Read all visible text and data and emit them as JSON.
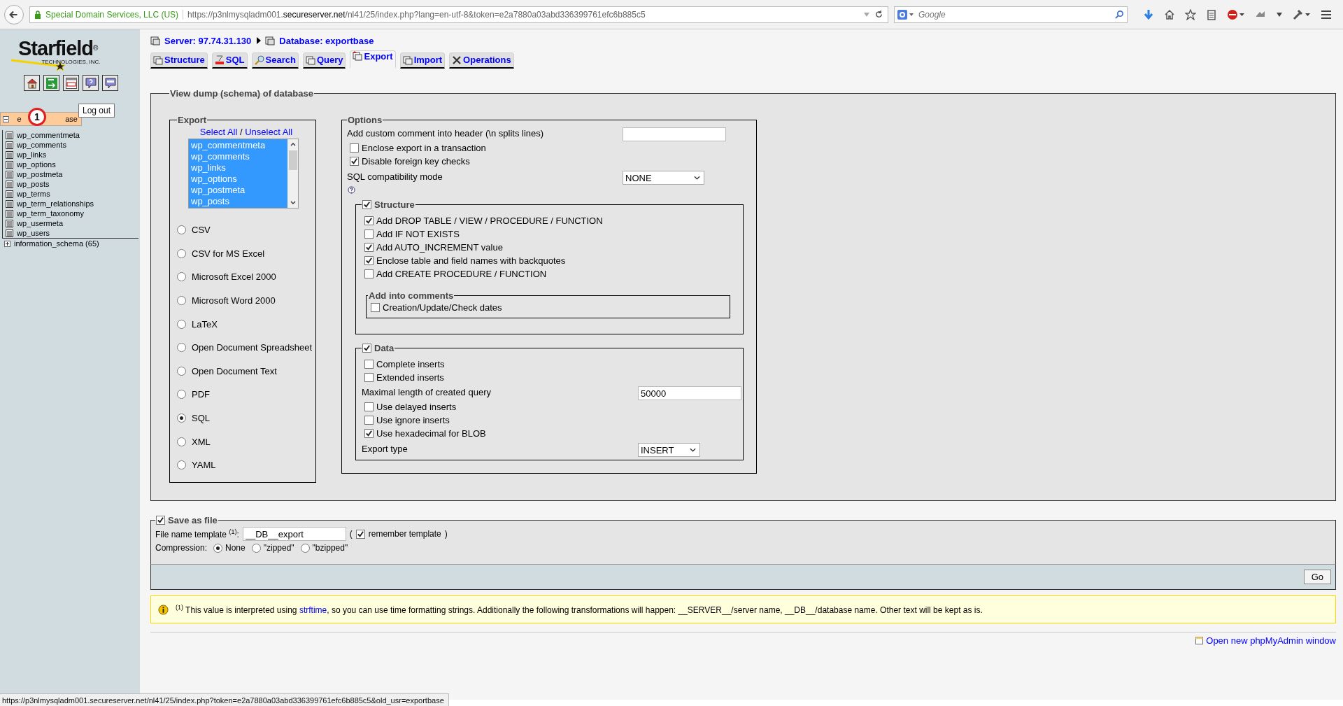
{
  "browser": {
    "identity": "Special Domain Services, LLC (US)",
    "url": "https://p3nlmysqladm001.**secureserver.net**/nl41/25/index.php?lang=en-utf-8&token=e2a7880a03abd336399761efc6b885c5",
    "search_placeholder": "Google"
  },
  "sidebar": {
    "logo": {
      "name": "Starfield",
      "mark": "®",
      "sub": "TECHNOLOGIES, INC."
    },
    "tooltip": "Log out",
    "annotation": "1",
    "database": {
      "label_start": "e",
      "label_end": "ase",
      "expanded": true,
      "selected": true,
      "tables": [
        {
          "label": "wp_commentmeta"
        },
        {
          "label": "wp_comments"
        },
        {
          "label": "wp_links"
        },
        {
          "label": "wp_options"
        },
        {
          "label": "wp_postmeta"
        },
        {
          "label": "wp_posts"
        },
        {
          "label": "wp_terms"
        },
        {
          "label": "wp_term_relationships"
        },
        {
          "label": "wp_term_taxonomy"
        },
        {
          "label": "wp_usermeta"
        },
        {
          "label": "wp_users"
        }
      ]
    },
    "other_databases": [
      {
        "label": "information_schema (65)",
        "expanded": false
      }
    ]
  },
  "breadcrumb": [
    {
      "label": "Server: 97.74.31.130"
    },
    {
      "label": "Database: exportbase"
    }
  ],
  "tabs": [
    {
      "label": "Structure",
      "selected": false
    },
    {
      "label": "SQL",
      "selected": false
    },
    {
      "label": "Search",
      "selected": false
    },
    {
      "label": "Query",
      "selected": false
    },
    {
      "label": "Export",
      "selected": true
    },
    {
      "label": "Import",
      "selected": false
    },
    {
      "label": "Operations",
      "selected": false
    }
  ],
  "main": {
    "legend": "View dump (schema) of database",
    "export": {
      "legend": "Export",
      "select_all": "Select All",
      "separator": "/",
      "unselect_all": "Unselect All",
      "tables": [
        {
          "label": "wp_commentmeta",
          "selected": true
        },
        {
          "label": "wp_comments",
          "selected": true
        },
        {
          "label": "wp_links",
          "selected": true
        },
        {
          "label": "wp_options",
          "selected": true
        },
        {
          "label": "wp_postmeta",
          "selected": true
        },
        {
          "label": "wp_posts",
          "selected": true
        }
      ],
      "formats": [
        {
          "label": "CSV",
          "selected": false
        },
        {
          "label": "CSV for MS Excel",
          "selected": false
        },
        {
          "label": "Microsoft Excel 2000",
          "selected": false
        },
        {
          "label": "Microsoft Word 2000",
          "selected": false
        },
        {
          "label": "LaTeX",
          "selected": false
        },
        {
          "label": "Open Document Spreadsheet",
          "selected": false
        },
        {
          "label": "Open Document Text",
          "selected": false
        },
        {
          "label": "PDF",
          "selected": false
        },
        {
          "label": "SQL",
          "selected": true
        },
        {
          "label": "XML",
          "selected": false
        },
        {
          "label": "YAML",
          "selected": false
        }
      ]
    },
    "options": {
      "legend": "Options",
      "comment_label": "Add custom comment into header (\\n splits lines)",
      "checks": [
        {
          "label": "Enclose export in a transaction",
          "checked": false
        },
        {
          "label": "Disable foreign key checks",
          "checked": true
        }
      ],
      "compat_label": "SQL compatibility mode",
      "compat_value": "NONE",
      "structure": {
        "legend": "Structure",
        "checked": true,
        "items": [
          {
            "label": "Add DROP TABLE / VIEW / PROCEDURE / FUNCTION",
            "checked": true
          },
          {
            "label": "Add IF NOT EXISTS",
            "checked": false
          },
          {
            "label": "Add AUTO_INCREMENT value",
            "checked": true
          },
          {
            "label": "Enclose table and field names with backquotes",
            "checked": true
          },
          {
            "label": "Add CREATE PROCEDURE / FUNCTION",
            "checked": false
          }
        ],
        "comments": {
          "legend": "Add into comments",
          "items": [
            {
              "label": "Creation/Update/Check dates",
              "checked": false
            }
          ]
        }
      },
      "data": {
        "legend": "Data",
        "checked": true,
        "rows": [
          {
            "kind": "check",
            "label": "Complete inserts",
            "checked": false
          },
          {
            "kind": "check",
            "label": "Extended inserts",
            "checked": false
          },
          {
            "kind": "input",
            "label": "Maximal length of created query",
            "value": "50000"
          },
          {
            "kind": "check",
            "label": "Use delayed inserts",
            "checked": false
          },
          {
            "kind": "check",
            "label": "Use ignore inserts",
            "checked": false
          },
          {
            "kind": "check",
            "label": "Use hexadecimal for BLOB",
            "checked": true
          },
          {
            "kind": "select",
            "label": "Export type",
            "value": "INSERT"
          }
        ]
      }
    }
  },
  "save": {
    "legend": "Save as file",
    "checked": true,
    "template_label": "File name template $^{(1)}$:",
    "template_value": "__DB__export",
    "paren_open": "(",
    "remember_label": "remember template",
    "remember_checked": true,
    "paren_close": ")",
    "compression_label": "Compression:",
    "compression": [
      {
        "label": "None",
        "selected": true
      },
      {
        "label": "\"zipped\"",
        "selected": false
      },
      {
        "label": "\"bzipped\"",
        "selected": false
      }
    ]
  },
  "go": "Go",
  "notice": {
    "before": "$^{(1)}$ This value is interpreted using",
    "link": "strftime",
    "after": ", so you can use time formatting strings. Additionally the following transformations will happen: __SERVER__/server name, __DB__/database name. Other text will be kept as is."
  },
  "footer_link": "Open new phpMyAdmin window",
  "status_bar": "https://p3nlmysqladm001.secureserver.net/nl41/25/index.php?token=e2a7880a03abd336399761efc6b885c5&old_usr=exportbase"
}
